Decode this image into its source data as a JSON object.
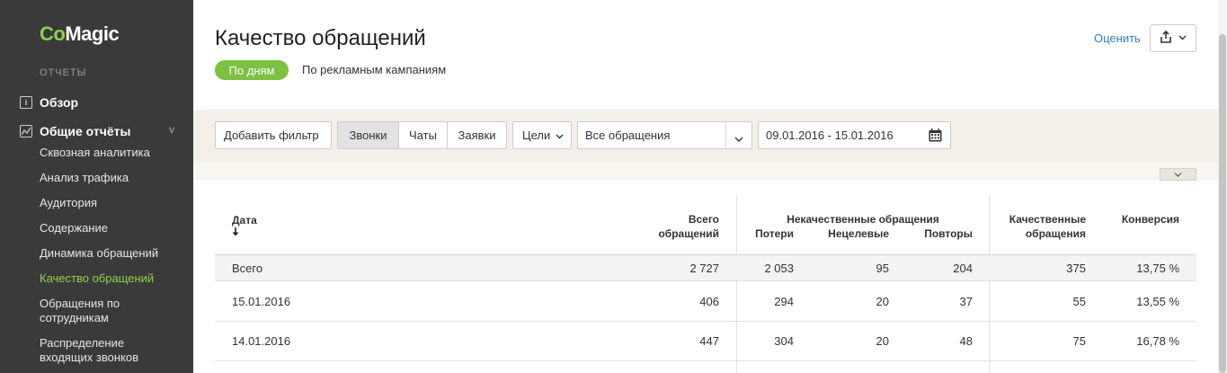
{
  "sidebar": {
    "logo_co": "Co",
    "logo_magic": "Magic",
    "section": "ОТЧЕТЫ",
    "overview": "Обзор",
    "general_reports": "Общие отчёты",
    "items": [
      "Сквозная аналитика",
      "Анализ трафика",
      "Аудитория",
      "Содержание",
      "Динамика обращений",
      "Качество обращений",
      "Обращения по сотрудникам",
      "Распределение входящих звонков"
    ]
  },
  "header": {
    "title": "Качество обращений",
    "pill": "По дням",
    "tab2": "По рекламным кампаниям",
    "rate": "Оценить"
  },
  "filters": {
    "add_filter": "Добавить фильтр",
    "calls": "Звонки",
    "chats": "Чаты",
    "requests": "Заявки",
    "goals": "Цели",
    "all_requests": "Все обращения",
    "date_range": "09.01.2016 - 15.01.2016"
  },
  "table": {
    "col_date": "Дата",
    "col_total_1": "Всего",
    "col_total_2": "обращений",
    "group_bad": "Некачественные обращения",
    "col_losses": "Потери",
    "col_untargeted": "Нецелевые",
    "col_repeats": "Повторы",
    "col_quality_1": "Качественные",
    "col_quality_2": "обращения",
    "col_conversion": "Конверсия",
    "rows": [
      {
        "date": "Всего",
        "total": "2 727",
        "losses": "2 053",
        "untargeted": "95",
        "repeats": "204",
        "quality": "375",
        "conversion": "13,75 %"
      },
      {
        "date": "15.01.2016",
        "total": "406",
        "losses": "294",
        "untargeted": "20",
        "repeats": "37",
        "quality": "55",
        "conversion": "13,55 %"
      },
      {
        "date": "14.01.2016",
        "total": "447",
        "losses": "304",
        "untargeted": "20",
        "repeats": "48",
        "quality": "75",
        "conversion": "16,78 %"
      }
    ]
  },
  "colors": {
    "accent": "#7cc142",
    "sidebar_bg": "#3a3a3a",
    "link": "#3a7bbf",
    "filter_bg": "#f2f0e8"
  }
}
